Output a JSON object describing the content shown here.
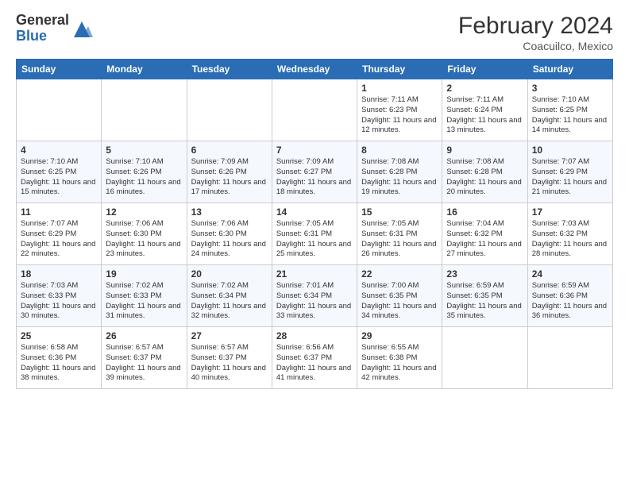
{
  "logo": {
    "general": "General",
    "blue": "Blue"
  },
  "header": {
    "month_year": "February 2024",
    "location": "Coacuilco, Mexico"
  },
  "weekdays": [
    "Sunday",
    "Monday",
    "Tuesday",
    "Wednesday",
    "Thursday",
    "Friday",
    "Saturday"
  ],
  "weeks": [
    [
      {
        "day": "",
        "info": ""
      },
      {
        "day": "",
        "info": ""
      },
      {
        "day": "",
        "info": ""
      },
      {
        "day": "",
        "info": ""
      },
      {
        "day": "1",
        "info": "Sunrise: 7:11 AM\nSunset: 6:23 PM\nDaylight: 11 hours and 12 minutes."
      },
      {
        "day": "2",
        "info": "Sunrise: 7:11 AM\nSunset: 6:24 PM\nDaylight: 11 hours and 13 minutes."
      },
      {
        "day": "3",
        "info": "Sunrise: 7:10 AM\nSunset: 6:25 PM\nDaylight: 11 hours and 14 minutes."
      }
    ],
    [
      {
        "day": "4",
        "info": "Sunrise: 7:10 AM\nSunset: 6:25 PM\nDaylight: 11 hours and 15 minutes."
      },
      {
        "day": "5",
        "info": "Sunrise: 7:10 AM\nSunset: 6:26 PM\nDaylight: 11 hours and 16 minutes."
      },
      {
        "day": "6",
        "info": "Sunrise: 7:09 AM\nSunset: 6:26 PM\nDaylight: 11 hours and 17 minutes."
      },
      {
        "day": "7",
        "info": "Sunrise: 7:09 AM\nSunset: 6:27 PM\nDaylight: 11 hours and 18 minutes."
      },
      {
        "day": "8",
        "info": "Sunrise: 7:08 AM\nSunset: 6:28 PM\nDaylight: 11 hours and 19 minutes."
      },
      {
        "day": "9",
        "info": "Sunrise: 7:08 AM\nSunset: 6:28 PM\nDaylight: 11 hours and 20 minutes."
      },
      {
        "day": "10",
        "info": "Sunrise: 7:07 AM\nSunset: 6:29 PM\nDaylight: 11 hours and 21 minutes."
      }
    ],
    [
      {
        "day": "11",
        "info": "Sunrise: 7:07 AM\nSunset: 6:29 PM\nDaylight: 11 hours and 22 minutes."
      },
      {
        "day": "12",
        "info": "Sunrise: 7:06 AM\nSunset: 6:30 PM\nDaylight: 11 hours and 23 minutes."
      },
      {
        "day": "13",
        "info": "Sunrise: 7:06 AM\nSunset: 6:30 PM\nDaylight: 11 hours and 24 minutes."
      },
      {
        "day": "14",
        "info": "Sunrise: 7:05 AM\nSunset: 6:31 PM\nDaylight: 11 hours and 25 minutes."
      },
      {
        "day": "15",
        "info": "Sunrise: 7:05 AM\nSunset: 6:31 PM\nDaylight: 11 hours and 26 minutes."
      },
      {
        "day": "16",
        "info": "Sunrise: 7:04 AM\nSunset: 6:32 PM\nDaylight: 11 hours and 27 minutes."
      },
      {
        "day": "17",
        "info": "Sunrise: 7:03 AM\nSunset: 6:32 PM\nDaylight: 11 hours and 28 minutes."
      }
    ],
    [
      {
        "day": "18",
        "info": "Sunrise: 7:03 AM\nSunset: 6:33 PM\nDaylight: 11 hours and 30 minutes."
      },
      {
        "day": "19",
        "info": "Sunrise: 7:02 AM\nSunset: 6:33 PM\nDaylight: 11 hours and 31 minutes."
      },
      {
        "day": "20",
        "info": "Sunrise: 7:02 AM\nSunset: 6:34 PM\nDaylight: 11 hours and 32 minutes."
      },
      {
        "day": "21",
        "info": "Sunrise: 7:01 AM\nSunset: 6:34 PM\nDaylight: 11 hours and 33 minutes."
      },
      {
        "day": "22",
        "info": "Sunrise: 7:00 AM\nSunset: 6:35 PM\nDaylight: 11 hours and 34 minutes."
      },
      {
        "day": "23",
        "info": "Sunrise: 6:59 AM\nSunset: 6:35 PM\nDaylight: 11 hours and 35 minutes."
      },
      {
        "day": "24",
        "info": "Sunrise: 6:59 AM\nSunset: 6:36 PM\nDaylight: 11 hours and 36 minutes."
      }
    ],
    [
      {
        "day": "25",
        "info": "Sunrise: 6:58 AM\nSunset: 6:36 PM\nDaylight: 11 hours and 38 minutes."
      },
      {
        "day": "26",
        "info": "Sunrise: 6:57 AM\nSunset: 6:37 PM\nDaylight: 11 hours and 39 minutes."
      },
      {
        "day": "27",
        "info": "Sunrise: 6:57 AM\nSunset: 6:37 PM\nDaylight: 11 hours and 40 minutes."
      },
      {
        "day": "28",
        "info": "Sunrise: 6:56 AM\nSunset: 6:37 PM\nDaylight: 11 hours and 41 minutes."
      },
      {
        "day": "29",
        "info": "Sunrise: 6:55 AM\nSunset: 6:38 PM\nDaylight: 11 hours and 42 minutes."
      },
      {
        "day": "",
        "info": ""
      },
      {
        "day": "",
        "info": ""
      }
    ]
  ]
}
